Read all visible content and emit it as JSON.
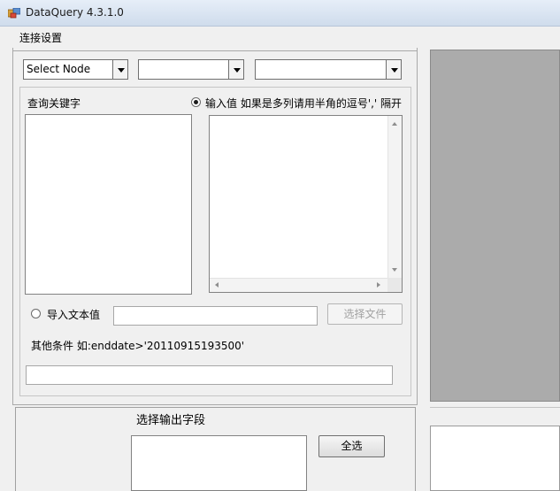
{
  "window": {
    "title": "DataQuery 4.3.1.0"
  },
  "connection": {
    "group_label": "连接设置",
    "node_select": "Select Node",
    "combo2_value": "",
    "combo3_value": ""
  },
  "query": {
    "keyword_label": "查询关键字",
    "input_value_label": "输入值 如果是多列请用半角的逗号',' 隔开",
    "import_label": "导入文本值",
    "import_path_value": "",
    "select_file_label": "选择文件",
    "other_conditions_label": "其他条件 如:enddate>'20110915193500'",
    "other_conditions_value": ""
  },
  "output": {
    "select_fields_label": "选择输出字段",
    "select_all_label": "全选"
  },
  "colors": {
    "right_panel_gray": "#ababab"
  },
  "icons": [
    "app-icon",
    "dropdown-arrow-icon",
    "scroll-up-icon",
    "scroll-down-icon",
    "scroll-left-icon",
    "scroll-right-icon"
  ]
}
